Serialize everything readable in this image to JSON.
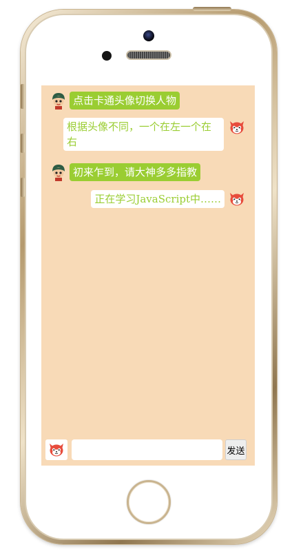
{
  "chat": {
    "messages": [
      {
        "side": "left",
        "avatar": "boy-avatar-icon",
        "text": "点击卡通头像切换人物"
      },
      {
        "side": "right",
        "avatar": "fox-avatar-icon",
        "text": "根据头像不同，一个在左一个在右"
      },
      {
        "side": "left",
        "avatar": "boy-avatar-icon",
        "text": "初来乍到，请大神多多指教"
      },
      {
        "side": "right",
        "avatar": "fox-avatar-icon",
        "text": "正在学习JavaScript中……"
      }
    ]
  },
  "composer": {
    "avatar": "fox-avatar-icon",
    "input_value": "",
    "send_label": "发送"
  },
  "colors": {
    "screen_background": "#f8dab7",
    "left_bubble": "#9acd32",
    "right_bubble_text": "#9acd32"
  }
}
